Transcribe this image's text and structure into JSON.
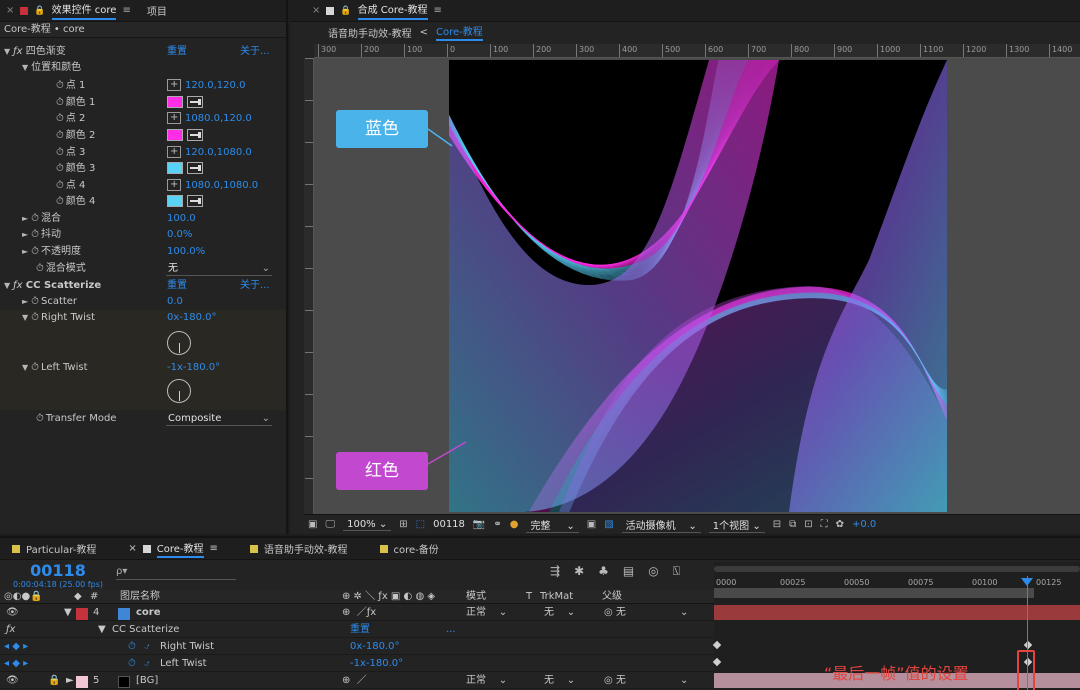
{
  "effect_controls": {
    "tab_close": "×",
    "tab_title": "效果控件 core",
    "tab_menu": "≡",
    "tab_project": "项目",
    "breadcrumb": "Core-教程 • core",
    "rows": {
      "fx1_name": "四色渐变",
      "fx1_reset": "重置",
      "fx1_about": "关于...",
      "pos_color": "位置和颜色",
      "p1_name": "点 1",
      "p1_val": "120.0,120.0",
      "c1_name": "颜色 1",
      "c1_color": "#ff2ee6",
      "p2_name": "点 2",
      "p2_val": "1080.0,120.0",
      "c2_name": "颜色 2",
      "c2_color": "#ff2ee6",
      "p3_name": "点 3",
      "p3_val": "120.0,1080.0",
      "c3_name": "颜色 3",
      "c3_color": "#5ad2f5",
      "p4_name": "点 4",
      "p4_val": "1080.0,1080.0",
      "c4_name": "颜色 4",
      "c4_color": "#5ad2f5",
      "blend_name": "混合",
      "blend_val": "100.0",
      "jitter_name": "抖动",
      "jitter_val": "0.0%",
      "opacity_name": "不透明度",
      "opacity_val": "100.0%",
      "mode_name": "混合模式",
      "mode_val": "无",
      "fx2_name": "CC Scatterize",
      "fx2_reset": "重置",
      "fx2_about": "关于...",
      "scatter_name": "Scatter",
      "scatter_val": "0.0",
      "rt_name": "Right Twist",
      "rt_val": "0x-180.0°",
      "lt_name": "Left Twist",
      "lt_val": "-1x-180.0°",
      "tm_name": "Transfer Mode",
      "tm_val": "Composite"
    }
  },
  "composition": {
    "tab_close": "×",
    "tab_title": "合成 Core-教程",
    "tab_menu": "≡",
    "crumb1": "语音助手动效-教程",
    "crumb_sep": "<",
    "crumb2": "Core-教程",
    "ruler_labels": [
      "300",
      "200",
      "100",
      "0",
      "100",
      "200",
      "300",
      "400",
      "500",
      "600",
      "700",
      "800",
      "900",
      "1000",
      "1100",
      "1200",
      "1300",
      "1400"
    ],
    "callout_blue": "蓝色",
    "callout_red": "红色",
    "zoom": "100%",
    "frame": "00118",
    "resolution": "完整",
    "camera": "活动摄像机",
    "views": "1个视图",
    "exposure": "+0.0",
    "colors": {
      "magenta": "#ff2ee6",
      "cyan": "#5ad2f5"
    }
  },
  "timeline": {
    "tabs": [
      {
        "label": "Particular-教程",
        "color": "#d9c24a",
        "close": ""
      },
      {
        "label": "Core-教程",
        "color": "#d6d6d6",
        "close": "×",
        "menu": "≡"
      },
      {
        "label": "语音助手动效-教程",
        "color": "#d9c24a",
        "close": ""
      },
      {
        "label": "core-备份",
        "color": "#d9c24a",
        "close": ""
      }
    ],
    "timecode": "00118",
    "timecode_sub": "0:00:04:18 (25.00 fps)",
    "search_placeholder": "ρ▾",
    "cols": {
      "num": "#",
      "name": "图层名称",
      "mode": "模式",
      "t": "T",
      "trkmat": "TrkMat",
      "parent": "父级"
    },
    "layer4": {
      "num": "4",
      "name": "core",
      "color": "#3f86d6",
      "mode": "正常",
      "trkmat": "无",
      "parent": "无"
    },
    "effect_row": {
      "name": "CC Scatterize",
      "reset": "重置",
      "more": "..."
    },
    "rt_row": {
      "name": "Right Twist",
      "val": "0x-180.0°"
    },
    "lt_row": {
      "name": "Left Twist",
      "val": "-1x-180.0°"
    },
    "layer5": {
      "num": "5",
      "name": "[BG]",
      "color": "#f2c6d6",
      "mode": "正常",
      "trkmat": "无",
      "parent": "无"
    },
    "ruler_labels": [
      "0000",
      "00025",
      "00050",
      "00075",
      "00100",
      "00125"
    ],
    "annotation": "“最后一帧”值的设置"
  }
}
